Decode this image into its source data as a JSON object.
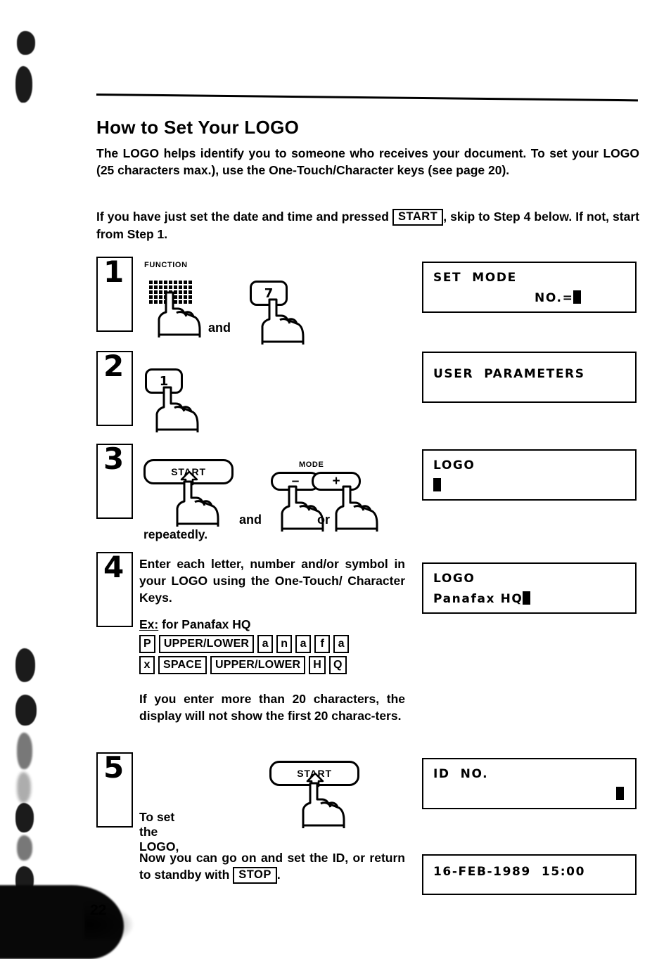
{
  "page": {
    "title": "How to Set Your LOGO",
    "page_number": "22"
  },
  "intro": {
    "paragraph_1": "The LOGO helps identify you to someone who receives your document. To set your LOGO (25 characters max.), use the One-Touch/Character keys (see page 20).",
    "paragraph_2_before": "If you have just set the date and time and pressed",
    "paragraph_2_key": "START",
    "paragraph_2_after": ", skip to Step 4 below. If not, start from Step 1."
  },
  "steps": [
    {
      "number": "1",
      "key_label": "FUNCTION",
      "keys": [
        {
          "type": "keypad-grid",
          "label": "FUNCTION"
        },
        {
          "type": "keycap",
          "label": "7"
        }
      ],
      "conjunction": "and",
      "display": {
        "line1": "SET  MODE",
        "line2": "NO.=",
        "cursor": true,
        "cursor_position": "after-line2"
      }
    },
    {
      "number": "2",
      "keys": [
        {
          "type": "keycap",
          "label": "1"
        }
      ],
      "display": {
        "line1": "USER  PARAMETERS",
        "line2": "",
        "cursor": false
      }
    },
    {
      "number": "3",
      "keys": [
        {
          "type": "keycap-wide",
          "label": "START"
        },
        {
          "type": "keycap-pill",
          "label": "–"
        },
        {
          "type": "keycap-pill",
          "label": "+"
        }
      ],
      "mode_label": "MODE",
      "conjunction_1": "and",
      "conjunction_2": "or",
      "note": "repeatedly.",
      "display": {
        "line1": "LOGO",
        "line2": "",
        "cursor": true,
        "cursor_position": "line2-start"
      }
    },
    {
      "number": "4",
      "body": "Enter each letter, number and/or symbol in your LOGO using the One-Touch/ Character Keys.",
      "example_label": "Ex:",
      "example_text": "for Panafax HQ",
      "key_sequence_row_1": [
        "P",
        "UPPER/LOWER",
        "a",
        "n",
        "a",
        "f",
        "a"
      ],
      "key_sequence_row_2": [
        "x",
        "SPACE",
        "UPPER/LOWER",
        "H",
        "Q"
      ],
      "note": "If you enter more than 20 characters, the display will not show the first 20 charac-ters.",
      "display": {
        "line1": "LOGO",
        "line2": "Panafax HQ",
        "cursor": true,
        "cursor_position": "after-line2"
      }
    },
    {
      "number": "5",
      "keys": [
        {
          "type": "keycap-wide",
          "label": "START"
        }
      ],
      "note": "To set the LOGO,",
      "display": {
        "line1": "ID  NO.",
        "line2": "",
        "cursor": true,
        "cursor_position": "line2-right"
      }
    }
  ],
  "closing": {
    "text_before": "Now you can go on and set the ID, or return to standby with",
    "key": "STOP",
    "text_after": ".",
    "display": {
      "line1": "16-FEB-1989  15:00",
      "line2": "",
      "cursor": false
    }
  },
  "colors": {
    "ink": "#000000",
    "paper": "#ffffff"
  }
}
